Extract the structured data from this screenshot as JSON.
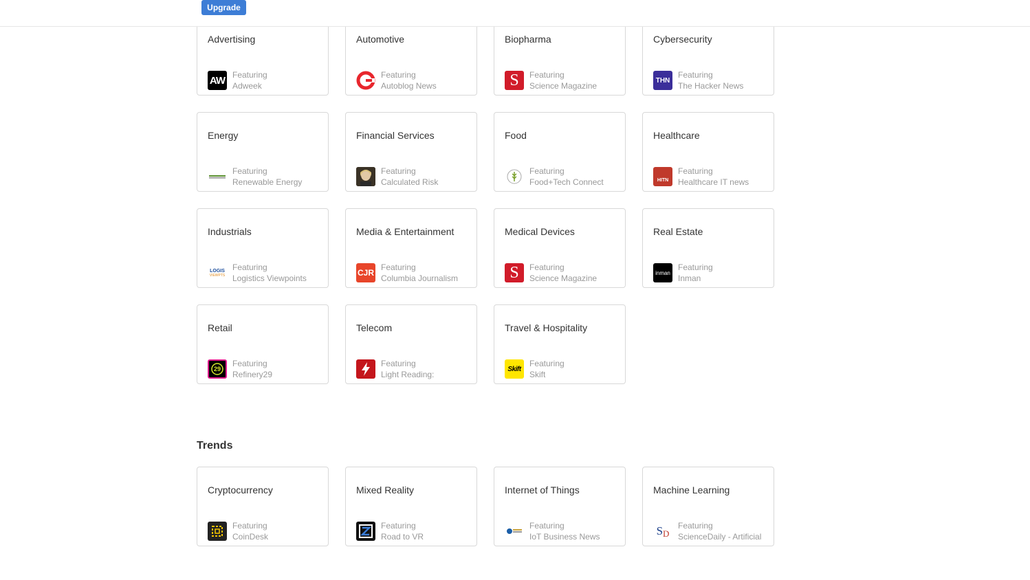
{
  "header": {
    "upgrade_label": "Upgrade"
  },
  "industries": [
    {
      "title": "Advertising",
      "featuring": "Featuring",
      "source": "Adweek",
      "logo": "aw-logo-icon"
    },
    {
      "title": "Automotive",
      "featuring": "Featuring",
      "source": "Autoblog News",
      "logo": "autoblog-logo-icon"
    },
    {
      "title": "Biopharma",
      "featuring": "Featuring",
      "source": "Science Magazine",
      "logo": "science-magazine-logo-icon"
    },
    {
      "title": "Cybersecurity",
      "featuring": "Featuring",
      "source": "The Hacker News",
      "logo": "thn-logo-icon"
    },
    {
      "title": "Energy",
      "featuring": "Featuring",
      "source": "Renewable Energy",
      "logo": "renewable-energy-logo-icon"
    },
    {
      "title": "Financial Services",
      "featuring": "Featuring",
      "source": "Calculated Risk",
      "logo": "calculated-risk-logo-icon"
    },
    {
      "title": "Food",
      "featuring": "Featuring",
      "source": "Food+Tech Connect",
      "logo": "food-tech-logo-icon"
    },
    {
      "title": "Healthcare",
      "featuring": "Featuring",
      "source": "Healthcare IT news",
      "logo": "hitn-logo-icon"
    },
    {
      "title": "Industrials",
      "featuring": "Featuring",
      "source": "Logistics Viewpoints",
      "logo": "logistics-viewpoints-logo-icon"
    },
    {
      "title": "Media & Entertainment",
      "featuring": "Featuring",
      "source": "Columbia Journalism",
      "logo": "cjr-logo-icon"
    },
    {
      "title": "Medical Devices",
      "featuring": "Featuring",
      "source": "Science Magazine",
      "logo": "science-magazine-logo-icon"
    },
    {
      "title": "Real Estate",
      "featuring": "Featuring",
      "source": "Inman",
      "logo": "inman-logo-icon"
    },
    {
      "title": "Retail",
      "featuring": "Featuring",
      "source": "Refinery29",
      "logo": "refinery29-logo-icon"
    },
    {
      "title": "Telecom",
      "featuring": "Featuring",
      "source": "Light Reading:",
      "logo": "light-reading-logo-icon"
    },
    {
      "title": "Travel & Hospitality",
      "featuring": "Featuring",
      "source": "Skift",
      "logo": "skift-logo-icon"
    }
  ],
  "trends_title": "Trends",
  "trends": [
    {
      "title": "Cryptocurrency",
      "featuring": "Featuring",
      "source": "CoinDesk",
      "logo": "coindesk-logo-icon"
    },
    {
      "title": "Mixed Reality",
      "featuring": "Featuring",
      "source": "Road to VR",
      "logo": "road-to-vr-logo-icon"
    },
    {
      "title": "Internet of Things",
      "featuring": "Featuring",
      "source": "IoT Business News",
      "logo": "iot-business-news-logo-icon"
    },
    {
      "title": "Machine Learning",
      "featuring": "Featuring",
      "source": "ScienceDaily - Artificial",
      "logo": "sciencedaily-logo-icon"
    }
  ],
  "logo_text": {
    "aw": "AW",
    "thn": "THN",
    "cjr": "CJR",
    "hitn": "HITN",
    "inman": "inman",
    "skift": "Skift",
    "science": "S",
    "sd_s": "S",
    "sd_d": "D",
    "logis": "LOGIS",
    "viewpts": "VIEWPTS",
    "r29": "29"
  },
  "colors": {
    "upgrade": "#3d7dd6",
    "card_border": "#d8d8d8",
    "title": "#333333",
    "muted": "#999999",
    "science_red": "#d11c2a",
    "thn_purple": "#3b2e9a",
    "cjr_orange": "#e8452a",
    "hitn_red": "#c0392b",
    "skift_yellow": "#ffe600",
    "refinery_pink": "#e0188c"
  }
}
